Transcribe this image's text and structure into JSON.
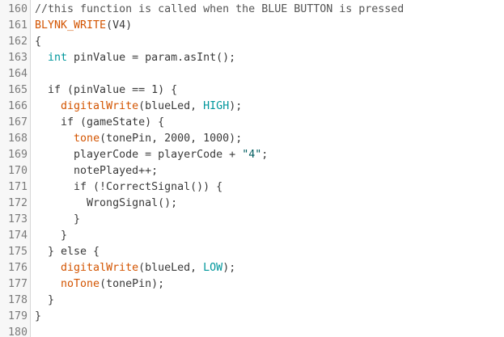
{
  "colors": {
    "background": "#ffffff",
    "gutter_background": "#f7f7f7",
    "line_number": "#7a7a7a",
    "plain_text": "#3a3a3a",
    "comment": "#555555",
    "function": "#d35400",
    "keyword": "#00979c",
    "string": "#005c5f"
  },
  "code_lines": [
    {
      "n": "160",
      "tokens": [
        {
          "t": "//this function is called when the BLUE BUTTON is pressed",
          "c": "comment"
        }
      ]
    },
    {
      "n": "161",
      "tokens": [
        {
          "t": "BLYNK_WRITE",
          "c": "func"
        },
        {
          "t": "(V4)",
          "c": "plain"
        }
      ]
    },
    {
      "n": "162",
      "tokens": [
        {
          "t": "{",
          "c": "plain"
        }
      ]
    },
    {
      "n": "163",
      "tokens": [
        {
          "t": "  ",
          "c": "plain"
        },
        {
          "t": "int",
          "c": "type"
        },
        {
          "t": " pinValue = param.asInt();",
          "c": "plain"
        }
      ]
    },
    {
      "n": "164",
      "tokens": []
    },
    {
      "n": "165",
      "tokens": [
        {
          "t": "  if (pinValue == 1) {",
          "c": "plain"
        }
      ]
    },
    {
      "n": "166",
      "tokens": [
        {
          "t": "    ",
          "c": "plain"
        },
        {
          "t": "digitalWrite",
          "c": "func"
        },
        {
          "t": "(blueLed, ",
          "c": "plain"
        },
        {
          "t": "HIGH",
          "c": "const"
        },
        {
          "t": ");",
          "c": "plain"
        }
      ]
    },
    {
      "n": "167",
      "tokens": [
        {
          "t": "    if (gameState) {",
          "c": "plain"
        }
      ]
    },
    {
      "n": "168",
      "tokens": [
        {
          "t": "      ",
          "c": "plain"
        },
        {
          "t": "tone",
          "c": "func"
        },
        {
          "t": "(tonePin, 2000, 1000);",
          "c": "plain"
        }
      ]
    },
    {
      "n": "169",
      "tokens": [
        {
          "t": "      playerCode = playerCode + ",
          "c": "plain"
        },
        {
          "t": "\"4\"",
          "c": "str"
        },
        {
          "t": ";",
          "c": "plain"
        }
      ]
    },
    {
      "n": "170",
      "tokens": [
        {
          "t": "      notePlayed++;",
          "c": "plain"
        }
      ]
    },
    {
      "n": "171",
      "tokens": [
        {
          "t": "      if (!CorrectSignal()) {",
          "c": "plain"
        }
      ]
    },
    {
      "n": "172",
      "tokens": [
        {
          "t": "        WrongSignal();",
          "c": "plain"
        }
      ]
    },
    {
      "n": "173",
      "tokens": [
        {
          "t": "      }",
          "c": "plain"
        }
      ]
    },
    {
      "n": "174",
      "tokens": [
        {
          "t": "    }",
          "c": "plain"
        }
      ]
    },
    {
      "n": "175",
      "tokens": [
        {
          "t": "  } else {",
          "c": "plain"
        }
      ]
    },
    {
      "n": "176",
      "tokens": [
        {
          "t": "    ",
          "c": "plain"
        },
        {
          "t": "digitalWrite",
          "c": "func"
        },
        {
          "t": "(blueLed, ",
          "c": "plain"
        },
        {
          "t": "LOW",
          "c": "const"
        },
        {
          "t": ");",
          "c": "plain"
        }
      ]
    },
    {
      "n": "177",
      "tokens": [
        {
          "t": "    ",
          "c": "plain"
        },
        {
          "t": "noTone",
          "c": "func"
        },
        {
          "t": "(tonePin);",
          "c": "plain"
        }
      ]
    },
    {
      "n": "178",
      "tokens": [
        {
          "t": "  }",
          "c": "plain"
        }
      ]
    },
    {
      "n": "179",
      "tokens": [
        {
          "t": "}",
          "c": "plain"
        }
      ]
    },
    {
      "n": "180",
      "tokens": []
    }
  ]
}
